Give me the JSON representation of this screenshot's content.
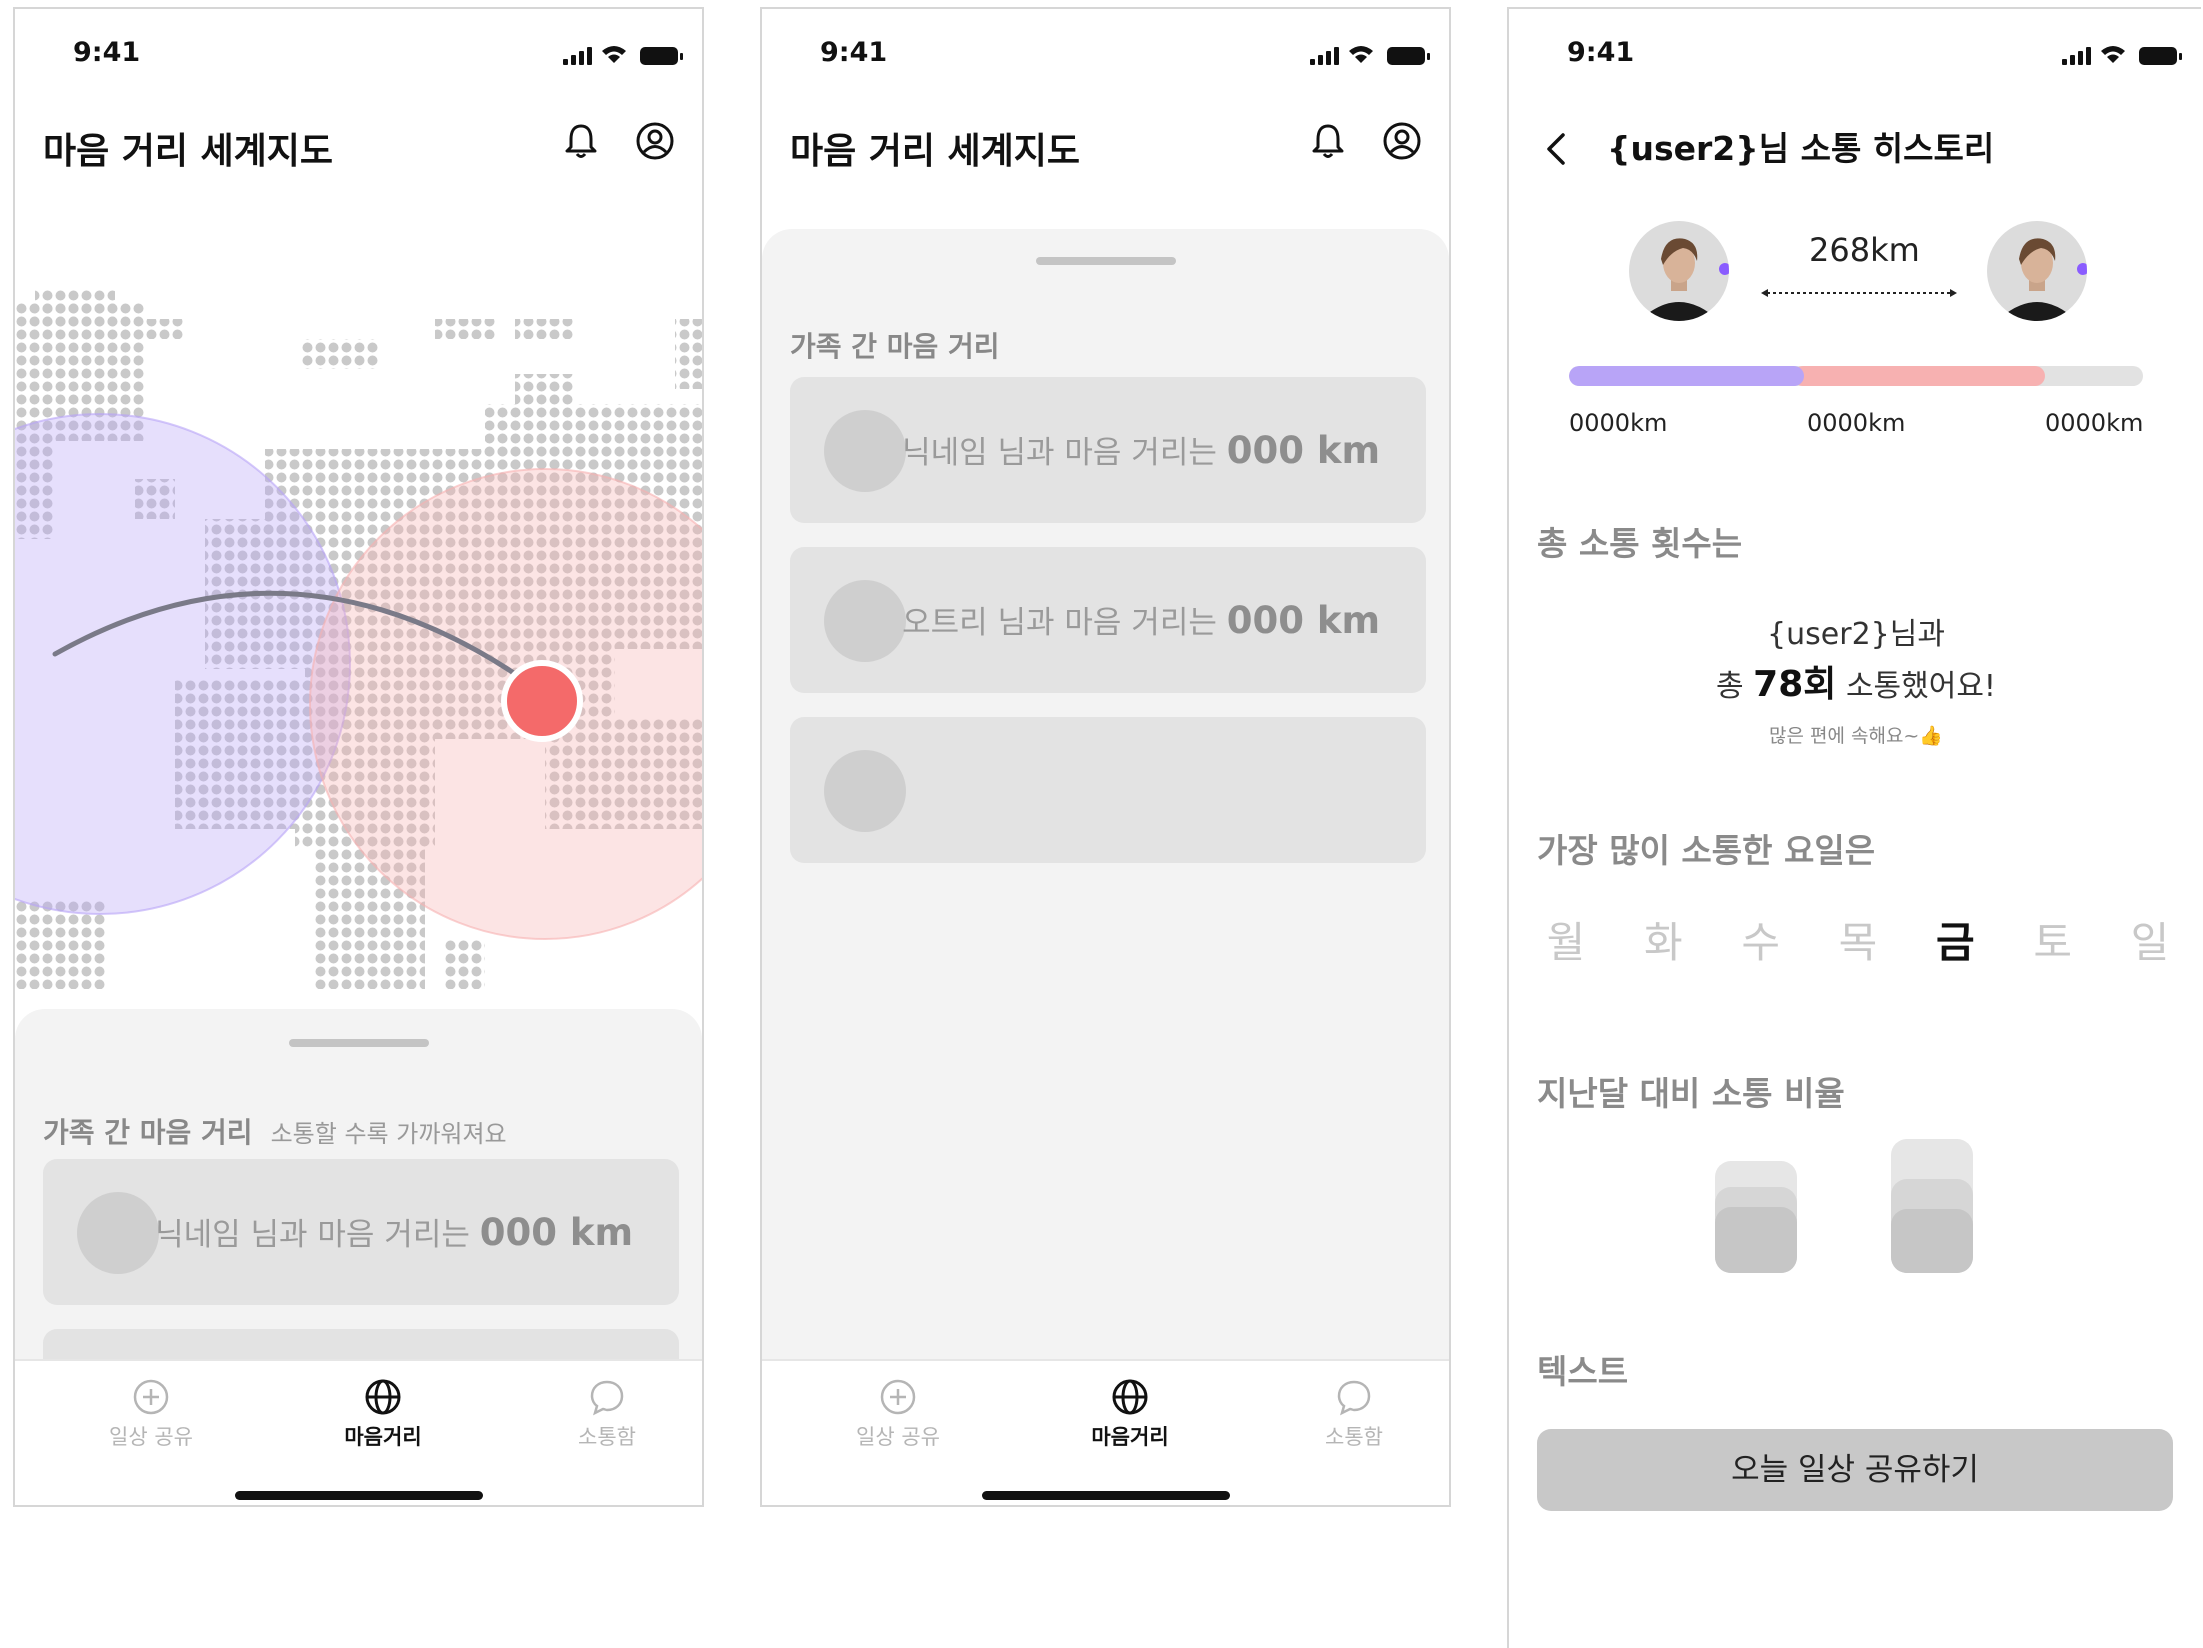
{
  "status": {
    "time": "9:41"
  },
  "screen1": {
    "title": "마음 거리 세계지도",
    "sheet": {
      "title": "가족 간 마음 거리",
      "subtitle": "소통할 수록 가까워져요",
      "cards": [
        {
          "text": "닉네임 님과 마음 거리는",
          "value": "000 km"
        }
      ]
    }
  },
  "screen2": {
    "title": "마음 거리 세계지도",
    "sheet": {
      "title": "가족 간 마음 거리",
      "cards": [
        {
          "text": "닉네임 님과 마음 거리는",
          "value": "000 km"
        },
        {
          "text": "오트리 님과 마음 거리는",
          "value": "000 km"
        },
        {
          "text": "",
          "value": ""
        }
      ]
    }
  },
  "tabs": [
    {
      "label": "일상 공유",
      "icon": "plus-circle-icon",
      "active": false
    },
    {
      "label": "마음거리",
      "icon": "globe-icon",
      "active": true
    },
    {
      "label": "소통함",
      "icon": "chat-bubble-icon",
      "active": false
    }
  ],
  "screen3": {
    "title": "{user2}님 소통 히스토리",
    "distance": "268km",
    "progress": {
      "purple_fraction": 0.41,
      "pink_fraction": 0.42
    },
    "km_labels": [
      "0000km",
      "0000km",
      "0000km"
    ],
    "total_section": {
      "heading": "총 소통 횟수는",
      "line1": "{user2}님과",
      "line2_prefix": "총",
      "count": "78회",
      "line2_suffix": "소통했어요!",
      "note": "많은 편에 속해요~👍"
    },
    "weekday_section": {
      "heading": "가장 많이 소통한 요일은",
      "days": [
        "월",
        "화",
        "수",
        "목",
        "금",
        "토",
        "일"
      ],
      "highlight": "금"
    },
    "ratio_section": {
      "heading": "지난달 대비 소통 비율"
    },
    "text_section": {
      "heading": "텍스트"
    },
    "cta_label": "오늘 일상 공유하기"
  },
  "colors": {
    "purple": "#b8a4f7",
    "pink": "#f7b1b1",
    "marker_red": "#f46a6a",
    "sheet_bg": "#f3f3f3",
    "card_bg": "#e3e3e3"
  }
}
